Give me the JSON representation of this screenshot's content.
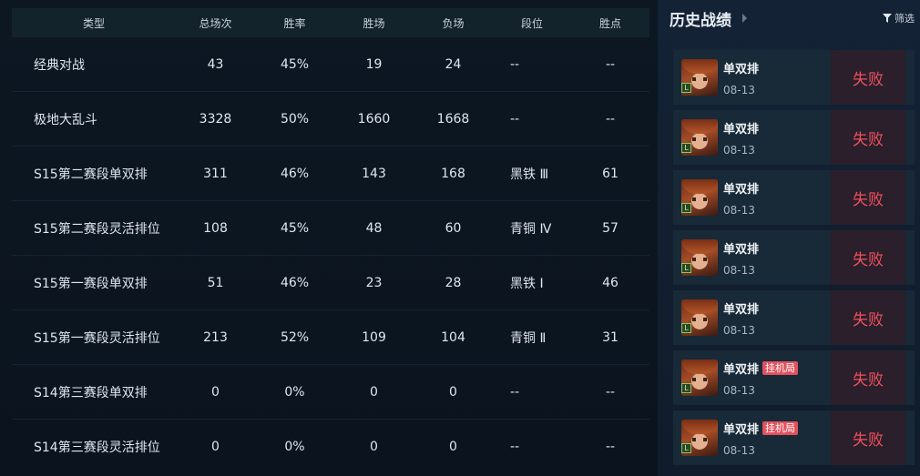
{
  "stats": {
    "headers": {
      "type": "类型",
      "total": "总场次",
      "rate": "胜率",
      "wins": "胜场",
      "losses": "负场",
      "tier": "段位",
      "points": "胜点"
    },
    "rows": [
      {
        "type": "经典对战",
        "total": "43",
        "rate": "45%",
        "wins": "19",
        "losses": "24",
        "tier": "--",
        "points": "--"
      },
      {
        "type": "极地大乱斗",
        "total": "3328",
        "rate": "50%",
        "wins": "1660",
        "losses": "1668",
        "tier": "--",
        "points": "--"
      },
      {
        "type": "S15第二赛段单双排",
        "total": "311",
        "rate": "46%",
        "wins": "143",
        "losses": "168",
        "tier": "黑铁 Ⅲ",
        "points": "61"
      },
      {
        "type": "S15第二赛段灵活排位",
        "total": "108",
        "rate": "45%",
        "wins": "48",
        "losses": "60",
        "tier": "青铜 Ⅳ",
        "points": "57"
      },
      {
        "type": "S15第一赛段单双排",
        "total": "51",
        "rate": "46%",
        "wins": "23",
        "losses": "28",
        "tier": "黑铁 Ⅰ",
        "points": "46"
      },
      {
        "type": "S15第一赛段灵活排位",
        "total": "213",
        "rate": "52%",
        "wins": "109",
        "losses": "104",
        "tier": "青铜 Ⅱ",
        "points": "31"
      },
      {
        "type": "S14第三赛段单双排",
        "total": "0",
        "rate": "0%",
        "wins": "0",
        "losses": "0",
        "tier": "--",
        "points": "--"
      },
      {
        "type": "S14第三赛段灵活排位",
        "total": "0",
        "rate": "0%",
        "wins": "0",
        "losses": "0",
        "tier": "--",
        "points": "--"
      }
    ]
  },
  "history": {
    "title": "历史战绩",
    "filter_label": "筛选",
    "matches": [
      {
        "mode": "单双排",
        "tag": "",
        "date": "08-13",
        "result": "失败",
        "level": "L"
      },
      {
        "mode": "单双排",
        "tag": "",
        "date": "08-13",
        "result": "失败",
        "level": "L"
      },
      {
        "mode": "单双排",
        "tag": "",
        "date": "08-13",
        "result": "失败",
        "level": "L"
      },
      {
        "mode": "单双排",
        "tag": "",
        "date": "08-13",
        "result": "失败",
        "level": "L"
      },
      {
        "mode": "单双排",
        "tag": "",
        "date": "08-13",
        "result": "失败",
        "level": "L"
      },
      {
        "mode": "单双排",
        "tag": "挂机局",
        "date": "08-13",
        "result": "失败",
        "level": "L"
      },
      {
        "mode": "单双排",
        "tag": "挂机局",
        "date": "08-13",
        "result": "失败",
        "level": "L"
      }
    ]
  },
  "colors": {
    "accent_loss": "#f0505f",
    "afk_tag": "#e0515e"
  },
  "icons": {
    "filter": "funnel-icon",
    "title_arrow": "chevron-right-icon",
    "avatar": "champion-avatar"
  }
}
